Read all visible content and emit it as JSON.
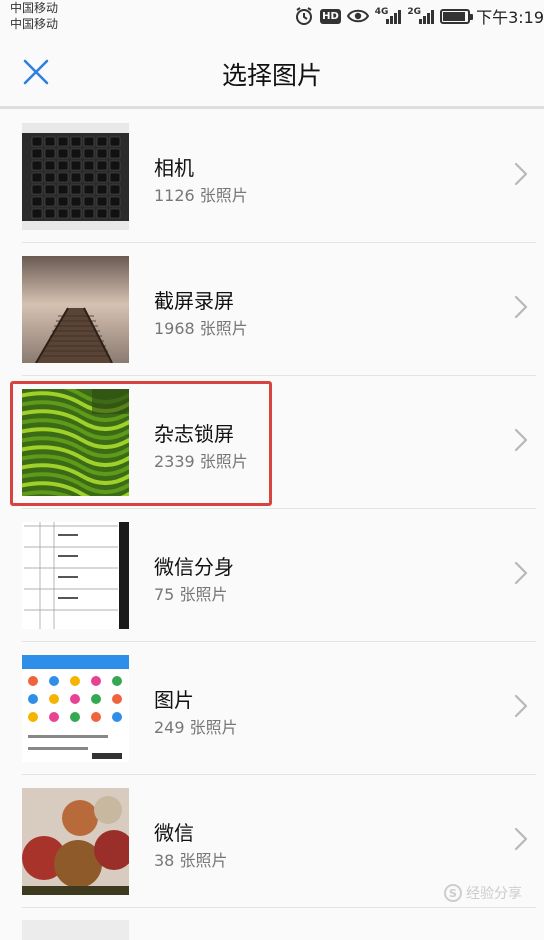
{
  "status_bar": {
    "carrier_1": "中国移动",
    "carrier_2": "中国移动",
    "hd_label": "HD",
    "network_1": "4G",
    "network_2": "2G",
    "battery_level": 0.9,
    "time": "下午3:19",
    "icons": [
      "alarm-clock-icon",
      "hd-icon",
      "eye-comfort-icon",
      "signal-icon",
      "signal-icon",
      "battery-icon"
    ]
  },
  "header": {
    "title": "选择图片",
    "close_icon": "close-icon",
    "accent_color": "#2f7fe0"
  },
  "albums": [
    {
      "name": "相机",
      "count": "1126 张照片",
      "thumb": "keyboard"
    },
    {
      "name": "截屏录屏",
      "count": "1968 张照片",
      "thumb": "pier"
    },
    {
      "name": "杂志锁屏",
      "count": "2339 张照片",
      "thumb": "terraces",
      "highlighted": true
    },
    {
      "name": "微信分身",
      "count": "75 张照片",
      "thumb": "table"
    },
    {
      "name": "图片",
      "count": "249 张照片",
      "thumb": "app-screen"
    },
    {
      "name": "微信",
      "count": "38 张照片",
      "thumb": "fruit"
    }
  ],
  "highlight_color": "#d9433f",
  "watermark": {
    "text": "经验分享"
  }
}
